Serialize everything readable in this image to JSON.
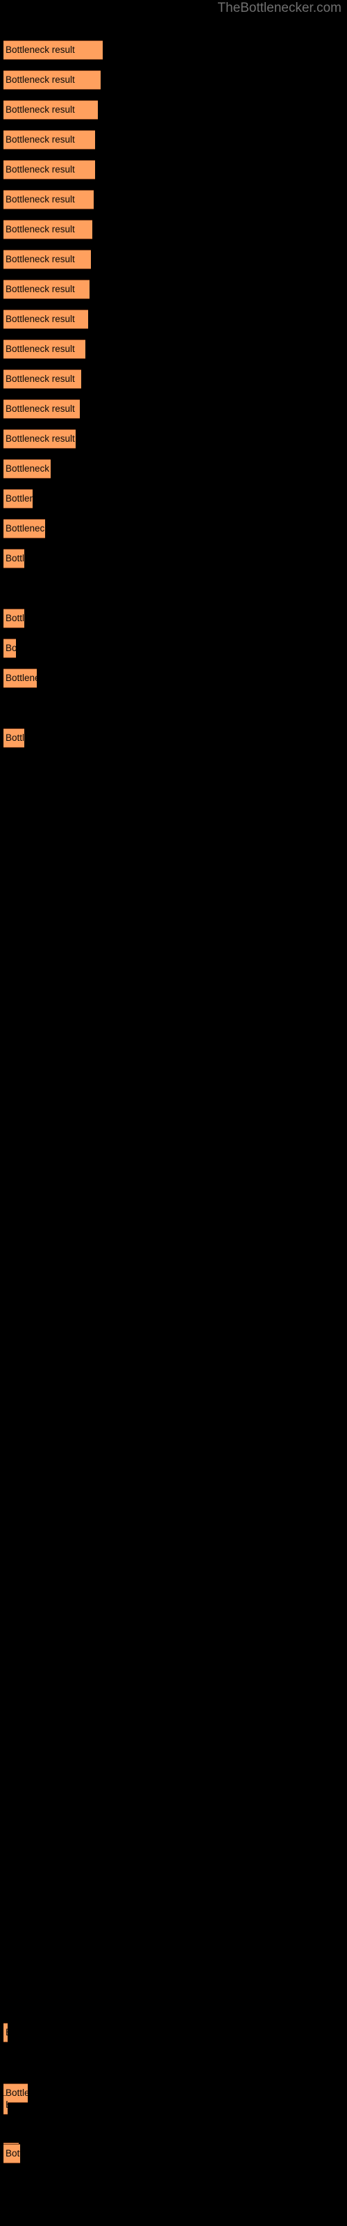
{
  "site": {
    "title": "TheBottlenecker.com",
    "title_color": "#707070"
  },
  "theme": {
    "background": "#000000",
    "bar_fill": "#FFA05E",
    "bar_border": "#7A3F1C",
    "bar_label_color": "#0A0A0A"
  },
  "chart_data": {
    "type": "bar",
    "orientation": "horizontal",
    "title": "",
    "subtitle": "",
    "xlabel": "",
    "ylabel": "",
    "grid": false,
    "legend": null,
    "xlim": [
      0,
      495
    ],
    "bar_label_text": "Bottleneck result",
    "categories": [
      "Bottleneck result",
      "Bottleneck result",
      "Bottleneck result",
      "Bottleneck result",
      "Bottleneck result",
      "Bottleneck result",
      "Bottleneck result",
      "Bottleneck result",
      "Bottleneck result",
      "Bottleneck result",
      "Bottleneck result",
      "Bottleneck result",
      "Bottleneck result",
      "Bottleneck result",
      "Bottleneck result",
      "Bottleneck result",
      "Bottleneck result",
      "Bottleneck result",
      "Bottleneck result",
      "Bottleneck result",
      "Bottleneck result",
      "Bottleneck result",
      "Bottleneck result",
      "Bottleneck result",
      "Bottleneck result",
      "Bottleneck result",
      "Bottleneck result"
    ],
    "values": [
      143,
      140,
      136,
      132,
      132,
      130,
      128,
      126,
      124,
      122,
      118,
      112,
      110,
      104,
      68,
      42,
      60,
      30,
      30,
      18,
      48,
      30,
      6,
      35,
      6,
      22,
      24
    ],
    "bars": [
      {
        "label": "Bottleneck result",
        "width": 143,
        "top": 58
      },
      {
        "label": "Bottleneck result",
        "width": 140,
        "top": 101
      },
      {
        "label": "Bottleneck result",
        "width": 136,
        "top": 144
      },
      {
        "label": "Bottleneck result",
        "width": 132,
        "top": 187
      },
      {
        "label": "Bottleneck result",
        "width": 132,
        "top": 230
      },
      {
        "label": "Bottleneck result",
        "width": 130,
        "top": 273
      },
      {
        "label": "Bottleneck result",
        "width": 128,
        "top": 316
      },
      {
        "label": "Bottleneck result",
        "width": 126,
        "top": 359
      },
      {
        "label": "Bottleneck result",
        "width": 124,
        "top": 402
      },
      {
        "label": "Bottleneck result",
        "width": 122,
        "top": 445
      },
      {
        "label": "Bottleneck result",
        "width": 118,
        "top": 488
      },
      {
        "label": "Bottleneck result",
        "width": 112,
        "top": 531
      },
      {
        "label": "Bottleneck result",
        "width": 110,
        "top": 574
      },
      {
        "label": "Bottleneck result",
        "width": 104,
        "top": 617
      },
      {
        "label": "Bottleneck result",
        "width": 68,
        "top": 660
      },
      {
        "label": "Bottleneck result",
        "width": 42,
        "top": 703
      },
      {
        "label": "Bottleneck result",
        "width": 60,
        "top": 746
      },
      {
        "label": "Bottleneck result",
        "width": 30,
        "top": 789
      },
      {
        "label": "Bottleneck result",
        "width": 30,
        "top": 875
      },
      {
        "label": "Bottleneck result",
        "width": 18,
        "top": 918
      },
      {
        "label": "Bottleneck result",
        "width": 48,
        "top": 961
      },
      {
        "label": "Bottleneck result",
        "width": 30,
        "top": 1047
      },
      {
        "label": "Bottleneck result",
        "width": 6,
        "top": 2908
      },
      {
        "label": "Bottleneck result",
        "width": 35,
        "top": 2995
      },
      {
        "label": "Bottleneck result",
        "width": 6,
        "top": 3012
      },
      {
        "label": "Bottleneck result",
        "width": 22,
        "top": 3080
      },
      {
        "label": "Bottleneck result",
        "width": 24,
        "top": 3082
      }
    ]
  }
}
